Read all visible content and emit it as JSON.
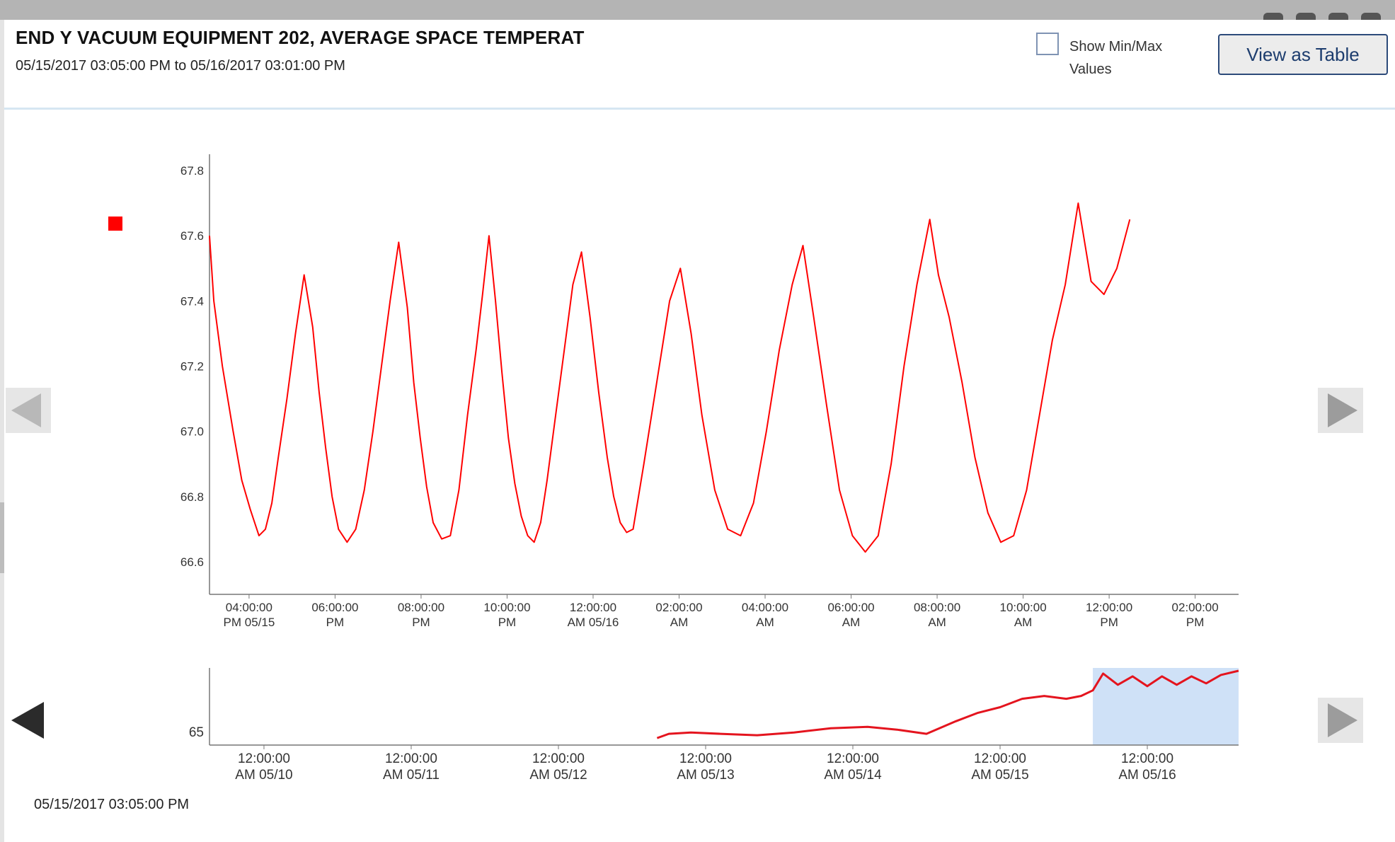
{
  "header": {
    "title": "END Y VACUUM EQUIPMENT 202, AVERAGE SPACE TEMPERAT",
    "range": "05/15/2017 03:05:00 PM to 05/16/2017 03:01:00 PM"
  },
  "controls": {
    "minmax_line1": "Show Min/Max",
    "minmax_line2": "Values",
    "view_table": "View as Table"
  },
  "colors": {
    "series": "#ff0000",
    "navigator_selection": "#cfe1f7",
    "navigator_line": "#e4141e"
  },
  "icons": {
    "prev_main": "triangle-left-icon",
    "next_main": "triangle-right-icon",
    "prev_navigator": "triangle-left-icon",
    "next_navigator": "triangle-right-icon"
  },
  "footer": {
    "date": "05/15/2017 03:05:00 PM"
  },
  "chart_data": [
    {
      "type": "line",
      "series_color": "#ff0000",
      "ylim": [
        66.5,
        67.85
      ],
      "yticks": [
        66.6,
        66.8,
        67.0,
        67.2,
        67.4,
        67.6,
        67.8
      ],
      "x_unit": "hours since 05/15/2017 03:05:00 PM",
      "xlim": [
        0,
        23.93
      ],
      "x_ticks": [
        {
          "x": 0.92,
          "line1": "04:00:00",
          "line2": "PM 05/15"
        },
        {
          "x": 2.92,
          "line1": "06:00:00",
          "line2": "PM"
        },
        {
          "x": 4.92,
          "line1": "08:00:00",
          "line2": "PM"
        },
        {
          "x": 6.92,
          "line1": "10:00:00",
          "line2": "PM"
        },
        {
          "x": 8.92,
          "line1": "12:00:00",
          "line2": "AM 05/16"
        },
        {
          "x": 10.92,
          "line1": "02:00:00",
          "line2": "AM"
        },
        {
          "x": 12.92,
          "line1": "04:00:00",
          "line2": "AM"
        },
        {
          "x": 14.92,
          "line1": "06:00:00",
          "line2": "AM"
        },
        {
          "x": 16.92,
          "line1": "08:00:00",
          "line2": "AM"
        },
        {
          "x": 18.92,
          "line1": "10:00:00",
          "line2": "AM"
        },
        {
          "x": 20.92,
          "line1": "12:00:00",
          "line2": "PM"
        },
        {
          "x": 22.92,
          "line1": "02:00:00",
          "line2": "PM"
        }
      ],
      "x": [
        0.0,
        0.1,
        0.3,
        0.55,
        0.75,
        0.95,
        1.15,
        1.3,
        1.45,
        1.6,
        1.8,
        2.0,
        2.2,
        2.4,
        2.55,
        2.7,
        2.85,
        3.0,
        3.2,
        3.4,
        3.6,
        3.8,
        4.0,
        4.2,
        4.4,
        4.6,
        4.75,
        4.9,
        5.05,
        5.2,
        5.4,
        5.6,
        5.8,
        6.0,
        6.2,
        6.35,
        6.5,
        6.65,
        6.8,
        6.95,
        7.1,
        7.25,
        7.4,
        7.55,
        7.7,
        7.85,
        8.05,
        8.25,
        8.45,
        8.65,
        8.85,
        9.05,
        9.25,
        9.4,
        9.55,
        9.7,
        9.85,
        10.1,
        10.4,
        10.7,
        10.95,
        11.2,
        11.45,
        11.75,
        12.05,
        12.35,
        12.65,
        12.95,
        13.25,
        13.55,
        13.8,
        14.05,
        14.35,
        14.65,
        14.95,
        15.25,
        15.55,
        15.85,
        16.15,
        16.45,
        16.75,
        16.95,
        17.2,
        17.5,
        17.8,
        18.1,
        18.4,
        18.7,
        19.0,
        19.3,
        19.6,
        19.9,
        20.2,
        20.5,
        20.8,
        21.1,
        21.4,
        21.7,
        22.0,
        22.3,
        22.6,
        22.9,
        23.1,
        23.3,
        23.5,
        23.7,
        23.93
      ],
      "values": [
        67.6,
        67.4,
        67.2,
        67.0,
        66.85,
        66.76,
        66.68,
        66.7,
        66.78,
        66.92,
        67.1,
        67.3,
        67.48,
        67.32,
        67.12,
        66.95,
        66.8,
        66.7,
        66.66,
        66.7,
        66.82,
        67.0,
        67.2,
        67.4,
        67.58,
        67.38,
        67.15,
        66.98,
        66.83,
        66.72,
        66.67,
        66.68,
        66.82,
        67.05,
        67.25,
        67.42,
        67.6,
        67.4,
        67.18,
        66.98,
        66.84,
        66.74,
        66.68,
        66.66,
        66.72,
        66.85,
        67.05,
        67.25,
        67.45,
        67.55,
        67.35,
        67.12,
        66.92,
        66.8,
        66.72,
        66.69,
        66.7,
        66.9,
        67.15,
        67.4,
        67.5,
        67.3,
        67.05,
        66.82,
        66.7,
        66.68,
        66.78,
        67.0,
        67.25,
        67.45,
        67.57,
        67.35,
        67.08,
        66.82,
        66.68,
        66.63,
        66.68,
        66.9,
        67.2,
        67.45,
        67.65,
        67.48,
        67.35,
        67.15,
        66.92,
        66.75,
        66.66,
        66.68,
        66.82,
        67.05,
        67.28,
        67.45,
        67.7,
        67.46,
        67.42,
        67.5,
        67.65
      ]
    },
    {
      "type": "line",
      "role": "navigator",
      "series_color": "#e4141e",
      "ylim": [
        64.55,
        67.3
      ],
      "yticks": [
        65
      ],
      "x_unit": "days since 05/10/2017 12:00:00 AM",
      "xlim": [
        -0.37,
        6.62
      ],
      "selection": [
        5.63,
        6.62
      ],
      "x_ticks": [
        {
          "x": 0,
          "line1": "12:00:00",
          "line2": "AM 05/10"
        },
        {
          "x": 1,
          "line1": "12:00:00",
          "line2": "AM 05/11"
        },
        {
          "x": 2,
          "line1": "12:00:00",
          "line2": "AM 05/12"
        },
        {
          "x": 3,
          "line1": "12:00:00",
          "line2": "AM 05/13"
        },
        {
          "x": 4,
          "line1": "12:00:00",
          "line2": "AM 05/14"
        },
        {
          "x": 5,
          "line1": "12:00:00",
          "line2": "AM 05/15"
        },
        {
          "x": 6,
          "line1": "12:00:00",
          "line2": "AM 05/16"
        }
      ],
      "x": [
        2.67,
        2.75,
        2.9,
        3.1,
        3.35,
        3.6,
        3.85,
        4.1,
        4.3,
        4.5,
        4.7,
        4.85,
        5.0,
        5.15,
        5.3,
        5.45,
        5.55,
        5.63,
        5.7,
        5.8,
        5.9,
        6.0,
        6.1,
        6.2,
        6.3,
        6.4,
        6.5,
        6.62
      ],
      "values": [
        64.8,
        64.95,
        65.0,
        64.95,
        64.9,
        65.0,
        65.15,
        65.2,
        65.1,
        64.95,
        65.4,
        65.7,
        65.9,
        66.2,
        66.3,
        66.2,
        66.3,
        66.5,
        67.1,
        66.7,
        67.0,
        66.65,
        67.0,
        66.7,
        67.0,
        66.75,
        67.05,
        67.2
      ]
    }
  ]
}
